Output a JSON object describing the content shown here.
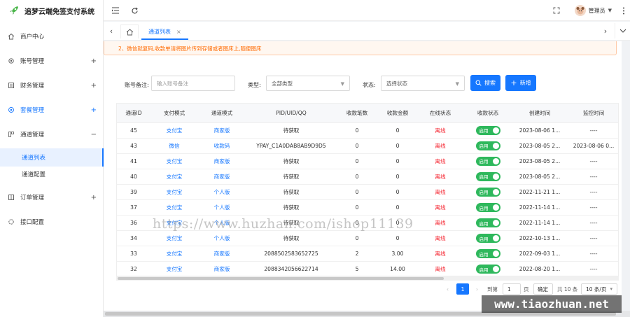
{
  "app": {
    "title": "追梦云端免签支付系统"
  },
  "sidebar": {
    "items": [
      {
        "label": "商户中心",
        "icon": "home-icon"
      },
      {
        "label": "账号管理",
        "icon": "gear-icon",
        "expand": "+"
      },
      {
        "label": "财务管理",
        "icon": "finance-icon",
        "expand": "+"
      },
      {
        "label": "套餐管理",
        "icon": "package-icon",
        "expand": "+"
      },
      {
        "label": "通道管理",
        "icon": "channel-icon",
        "expand": "−"
      },
      {
        "label": "订单管理",
        "icon": "order-icon",
        "expand": "+"
      },
      {
        "label": "接口配置",
        "icon": "api-icon"
      }
    ],
    "sub_items": [
      {
        "label": "通道列表"
      },
      {
        "label": "通道配置"
      }
    ]
  },
  "topbar": {
    "user_name": "管理员"
  },
  "tabs": {
    "active_label": "通道列表",
    "close": "×"
  },
  "notice": "2、微信就复码,收款单请将图片传到存储或者图床上,随便图床",
  "filters": {
    "account_label": "账号备注:",
    "account_placeholder": "输入账号备注",
    "type_label": "类型:",
    "type_value": "全部类型",
    "status_label": "状态:",
    "status_placeholder": "选择状态",
    "search_button": "搜索",
    "add_button": "新增"
  },
  "table": {
    "columns": [
      "通道ID",
      "支付模式",
      "通道模式",
      "PID/UID/QQ",
      "收款笔数",
      "收款金额",
      "在线状态",
      "收款状态",
      "创建时间",
      "监控时间"
    ],
    "rows": [
      [
        "45",
        "支付宝",
        "商家版",
        "待获取",
        "0",
        "0",
        "离线",
        "启用",
        "2023-08-06 1...",
        "----"
      ],
      [
        "43",
        "微信",
        "收款码",
        "YPAY_C1A0DAB8AB9D9D5",
        "0",
        "0",
        "离线",
        "启用",
        "2023-08-05 2...",
        "2023-08-06 0..."
      ],
      [
        "41",
        "支付宝",
        "商家版",
        "待获取",
        "0",
        "0",
        "离线",
        "启用",
        "2023-08-05 2...",
        "----"
      ],
      [
        "40",
        "支付宝",
        "商家版",
        "待获取",
        "0",
        "0",
        "离线",
        "启用",
        "2023-08-05 2...",
        "----"
      ],
      [
        "39",
        "支付宝",
        "个人版",
        "待获取",
        "0",
        "0",
        "离线",
        "启用",
        "2022-11-21 1...",
        "----"
      ],
      [
        "37",
        "支付宝",
        "个人版",
        "待获取",
        "0",
        "0",
        "离线",
        "启用",
        "2022-11-14 1...",
        "----"
      ],
      [
        "36",
        "支付宝",
        "个人版",
        "待获取",
        "0",
        "0",
        "离线",
        "启用",
        "2022-11-14 1...",
        "----"
      ],
      [
        "34",
        "支付宝",
        "个人版",
        "待获取",
        "0",
        "0",
        "离线",
        "启用",
        "2022-10-13 1...",
        "----"
      ],
      [
        "33",
        "支付宝",
        "商家版",
        "2088502583652725",
        "2",
        "3.00",
        "离线",
        "启用",
        "2022-09-03 1...",
        "----"
      ],
      [
        "32",
        "支付宝",
        "商家版",
        "2088342056622714",
        "5",
        "14.00",
        "离线",
        "启用",
        "2022-08-20 1...",
        "----"
      ]
    ]
  },
  "pagination": {
    "current_page": "1",
    "goto_label": "到第",
    "goto_value": "1",
    "page_unit": "页",
    "confirm": "确定",
    "total": "共 10 条",
    "page_size": "10 条/页"
  },
  "watermarks": {
    "center": "https://www.huzhan.com/ishop11139",
    "corner": "www.tiaozhuan.net"
  },
  "colors": {
    "primary": "#1677ff",
    "danger": "#f5222d",
    "success": "#2eb85c",
    "warning": "#ff6a00"
  }
}
